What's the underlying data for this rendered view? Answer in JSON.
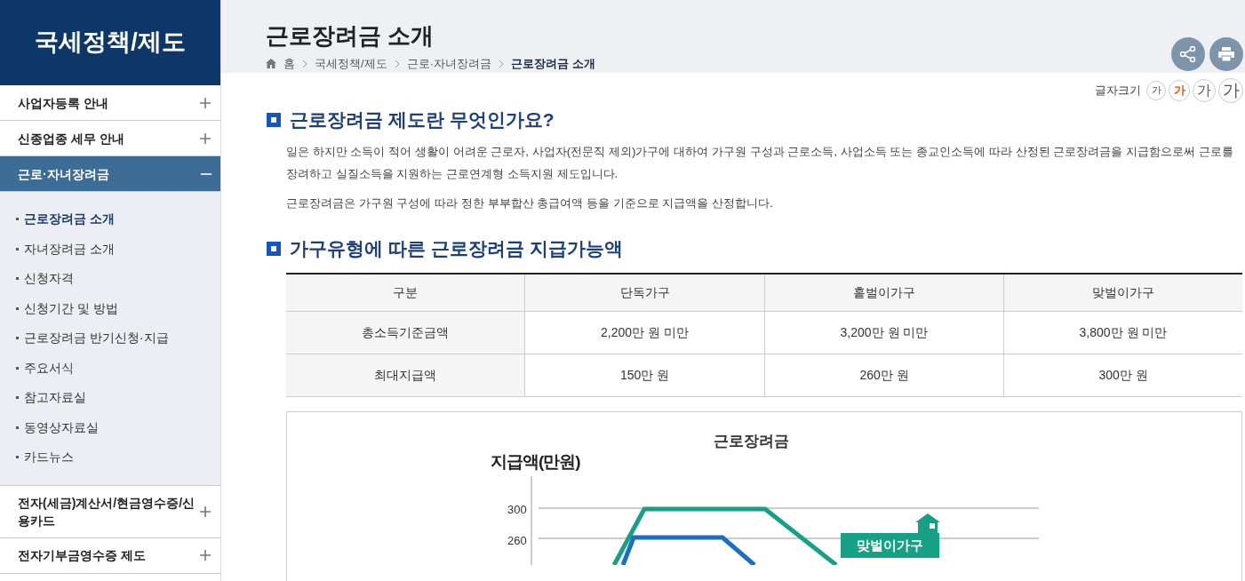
{
  "sidebar": {
    "title": "국세정책/제도",
    "items": [
      {
        "label": "사업자등록 안내",
        "expanded": false
      },
      {
        "label": "신종업종 세무 안내",
        "expanded": false
      },
      {
        "label": "근로·자녀장려금",
        "expanded": true,
        "children": [
          {
            "label": "근로장려금 소개",
            "selected": true
          },
          {
            "label": "자녀장려금 소개",
            "selected": false
          },
          {
            "label": "신청자격",
            "selected": false
          },
          {
            "label": "신청기간 및 방법",
            "selected": false
          },
          {
            "label": "근로장려금 반기신청·지급",
            "selected": false
          },
          {
            "label": "주요서식",
            "selected": false
          },
          {
            "label": "참고자료실",
            "selected": false
          },
          {
            "label": "동영상자료실",
            "selected": false
          },
          {
            "label": "카드뉴스",
            "selected": false
          }
        ]
      },
      {
        "label": "전자(세금)계산서/현금영수증/신용카드",
        "expanded": false
      },
      {
        "label": "전자기부금영수증 제도",
        "expanded": false
      }
    ]
  },
  "header": {
    "title": "근로장려금 소개",
    "breadcrumb": [
      "홈",
      "국세정책/제도",
      "근로·자녀장려금",
      "근로장려금 소개"
    ]
  },
  "font_size": {
    "label": "글자크기",
    "options": [
      {
        "label": "가",
        "selected": false
      },
      {
        "label": "가",
        "selected": true
      },
      {
        "label": "가",
        "selected": false
      },
      {
        "label": "가",
        "selected": false
      }
    ]
  },
  "sections": [
    {
      "heading": "근로장려금 제도란 무엇인가요?",
      "paragraphs": [
        "일은 하지만 소득이 적어 생활이 어려운 근로자, 사업자(전문직 제외)가구에 대하여 가구원 구성과 근로소득, 사업소득 또는 종교인소득에 따라 산정된 근로장려금을 지급함으로써 근로를 장려하고 실질소득을 지원하는 근로연계형 소득지원 제도입니다.",
        "근로장려금은 가구원 구성에 따라 정한 부부합산 총급여액 등을 기준으로 지급액을 산정합니다."
      ]
    },
    {
      "heading": "가구유형에 따른 근로장려금 지급가능액"
    }
  ],
  "table": {
    "columns": [
      "구분",
      "단독가구",
      "홑벌이가구",
      "맞벌이가구"
    ],
    "rows": [
      [
        "총소득기준금액",
        "2,200만 원 미만",
        "3,200만 원 미만",
        "3,800만 원 미만"
      ],
      [
        "최대지급액",
        "150만 원",
        "260만 원",
        "300만 원"
      ]
    ]
  },
  "chart_image": {
    "title": "근로장려금",
    "y_axis_label": "지급액(만원)",
    "ticks": [
      "300",
      "260"
    ],
    "series_label": "맞벌이가구"
  }
}
